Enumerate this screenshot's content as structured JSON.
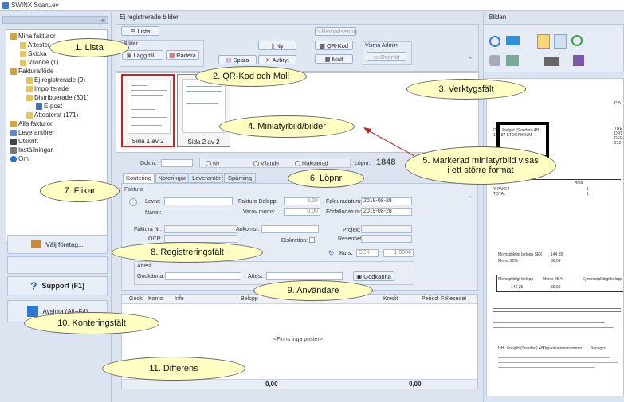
{
  "app": {
    "title": "SWINX ScanLev"
  },
  "sidebar": {
    "collapse": "«",
    "tree": [
      {
        "label": "Mina fakturor",
        "color": "#d8a23a"
      },
      {
        "label": "Attester",
        "color": "#e6c65a"
      },
      {
        "label": "Skicka",
        "color": "#e6c65a"
      },
      {
        "label": "Vilande (1)",
        "color": "#e6c65a"
      },
      {
        "label": "Fakturaflöde",
        "color": "#d8a23a"
      },
      {
        "label": "Ej registrerade (9)",
        "color": "#e6c65a"
      },
      {
        "label": "Importerade",
        "color": "#e6c65a"
      },
      {
        "label": "Distribuerade (301)",
        "color": "#e6c65a"
      },
      {
        "label": "E-post",
        "color": "#4a6fb0"
      },
      {
        "label": "Attesterat (171)",
        "color": "#e6c65a"
      },
      {
        "label": "Alla fakturor",
        "color": "#d8a23a"
      },
      {
        "label": "Leverantörer",
        "color": "#5a8bd0"
      },
      {
        "label": "Utskrift",
        "color": "#444"
      },
      {
        "label": "Inställningar",
        "color": "#777"
      },
      {
        "label": "Om",
        "color": "#2a6ed0"
      }
    ],
    "company_button": "Välj företag...",
    "support_button": "Support (F1)",
    "close_button": "Avsluta (Alt+F4)"
  },
  "main": {
    "panel_title": "Ej registrerade bilder",
    "list_button": "Lista",
    "bilder_group": "Bilder",
    "add_button": "Lägg till...",
    "delete_button": "Radera",
    "new_button": "Ny",
    "save_button": "Spara",
    "cancel_button": "Avbryt",
    "remodsering_button": "Remodsering",
    "qr_button": "QR-Kod",
    "template_button": "Mall",
    "visma_group": "Visma Admin",
    "transfer_button": "Överför",
    "thumbs": [
      {
        "caption": "Sida 1 av 2"
      },
      {
        "caption": "Sida 2 av 2"
      }
    ],
    "doknr_label": "Doknr:",
    "radios": [
      "Ny",
      "Vilande",
      "Makulerad"
    ],
    "lopnr_label": "Löpnr:",
    "lopnr_value": "1848",
    "tabs": [
      "Kontering",
      "Noteringar",
      "Leverantör",
      "Spårning"
    ],
    "form": {
      "section": "Faktura",
      "levnr": "Levnr:",
      "namn": "Namn:",
      "belopp_label": "Faktura Belopp:",
      "belopp_value": "0,00",
      "moms_label": "Varav moms:",
      "moms_value": "0,00",
      "fakturadatum_label": "Fakturadatum:",
      "fakturadatum_value": "2019-08-28",
      "forfallodatum_label": "Förfallodatum:",
      "forfallodatum_value": "2019-08-28",
      "fakturanr_label": "Faktura Nr:",
      "ocr_label": "OCR:",
      "ankomst_label": "Ankomst:",
      "diskretion_label": "Diskretion:",
      "projekt_label": "Projekt",
      "resenhet_label": "Resenhet",
      "kurs_label": "Kurs:",
      "kurs_currency": "SEK",
      "kurs_value": "1,0000",
      "attest_section": "Attest",
      "godkanna_label": "Godkänna:",
      "attest_label": "Attest:",
      "godkanna_button": "Godkänna"
    },
    "grid": {
      "columns": [
        "Godk",
        "Konto",
        "Info",
        "Belopp",
        "Kredit",
        "Period",
        "Följesedel"
      ],
      "empty": "<Finns inga poster>",
      "total_left": "0,00",
      "total_right": "0,00"
    }
  },
  "right": {
    "title": "Bilden",
    "doc_lines": [
      "DHL Freight (Sweden) AB",
      "170 87 STOCKHOLM",
      "P A",
      "TRE",
      "DRT",
      "DER",
      "212",
      "Antal",
      "Y PAKET",
      "TOTAL",
      "1",
      "1",
      "Momspliktigt belopp SEK",
      "144,35",
      "Moms 25%",
      "36,09",
      "Momspliktigt belopp",
      "Moms 25 %",
      "Ej momspliktigt belopp",
      "144,35",
      "36,09",
      "DHL Freight (Sweden) AB",
      "Organisationsnummer",
      "Bankgiro"
    ]
  },
  "callouts": [
    "1. Lista",
    "2. QR-Kod och Mall",
    "3. Verktygsfält",
    "4. Miniatyrbild/bilder",
    "5. Markerad miniatyrbild visas i ett större format",
    "6. Löpnr",
    "7. Flikar",
    "8. Registreringsfält",
    "9. Användare",
    "10. Konteringsfält",
    "11. Differens"
  ]
}
